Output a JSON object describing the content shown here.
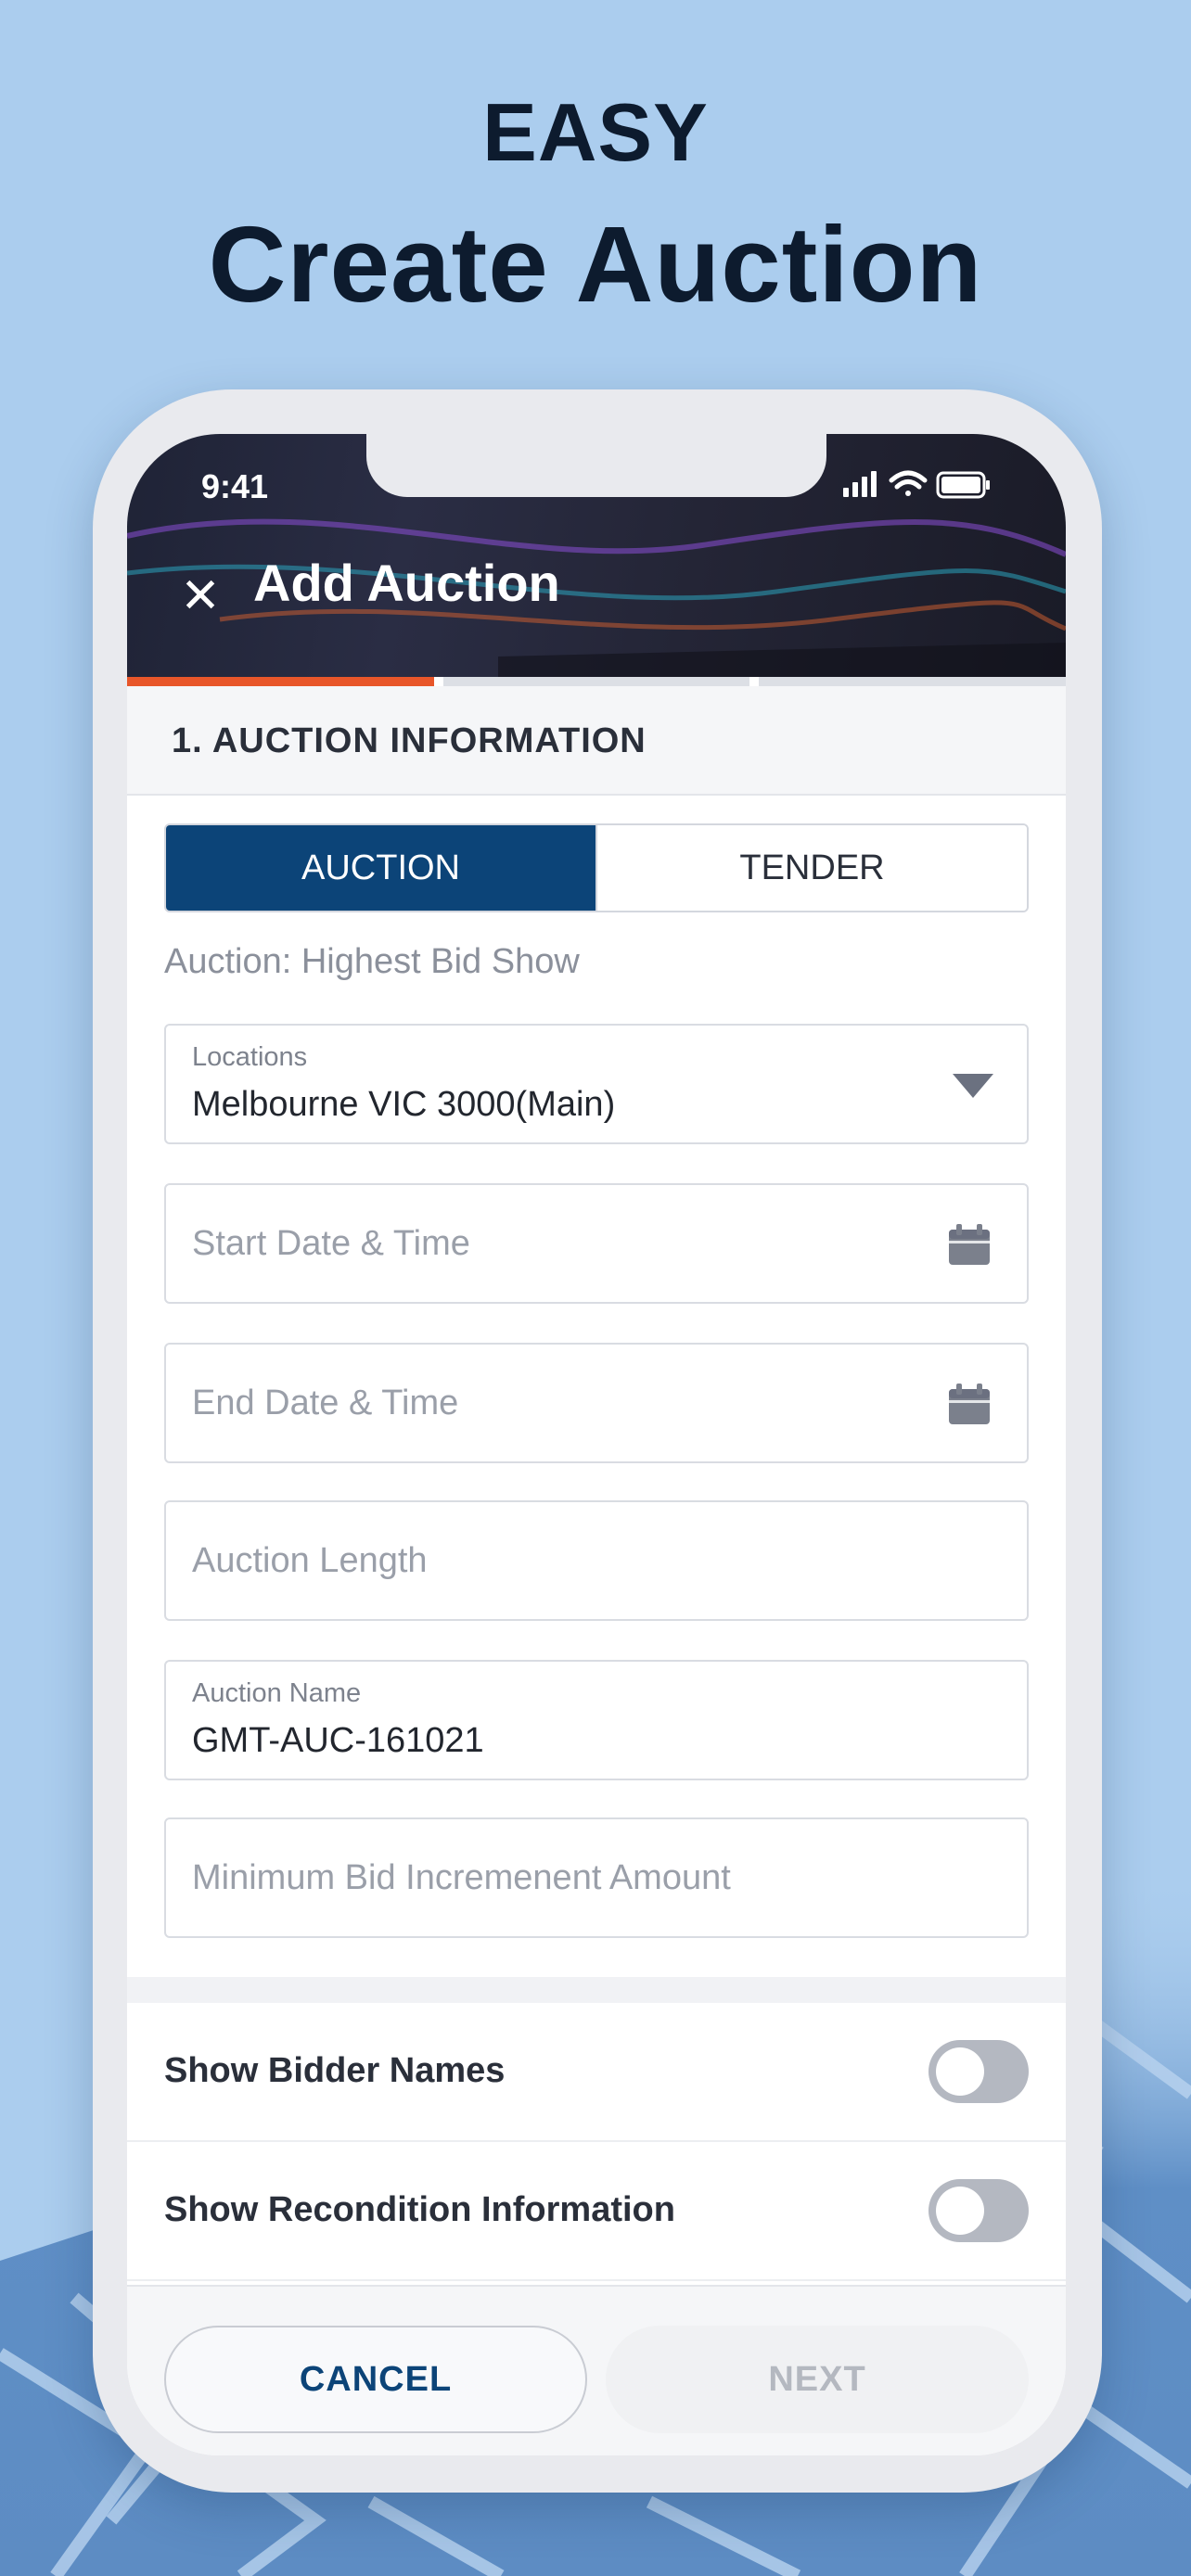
{
  "promo": {
    "eyebrow": "EASY",
    "headline": "Create Auction"
  },
  "status_bar": {
    "time": "9:41"
  },
  "header": {
    "title": "Add Auction"
  },
  "progress": {
    "steps": 3,
    "current_step": 1
  },
  "section": {
    "title": "1. AUCTION INFORMATION"
  },
  "type_toggle": {
    "options": [
      "AUCTION",
      "TENDER"
    ],
    "selected": "AUCTION"
  },
  "helper_text": "Auction: Highest Bid Show",
  "fields": {
    "location": {
      "label": "Locations",
      "value": "Melbourne VIC 3000(Main)"
    },
    "start": {
      "placeholder": "Start Date & Time"
    },
    "end": {
      "placeholder": "End Date & Time"
    },
    "length": {
      "placeholder": "Auction Length"
    },
    "name": {
      "label": "Auction Name",
      "value": "GMT-AUC-161021"
    },
    "min_bid": {
      "placeholder": "Minimum Bid Incremenent Amount"
    }
  },
  "toggles": {
    "bidder_names": {
      "label": "Show Bidder Names",
      "on": false
    },
    "recondition": {
      "label": "Show Recondition Information",
      "on": false
    }
  },
  "footer": {
    "cancel": "CANCEL",
    "next": "NEXT"
  },
  "colors": {
    "primary": "#0c4478",
    "progress": "#e8562a",
    "background": "#abcdee"
  },
  "icons": [
    "close-icon",
    "calendar-icon",
    "dropdown-arrow-icon",
    "signal-icon",
    "wifi-icon",
    "battery-icon"
  ]
}
